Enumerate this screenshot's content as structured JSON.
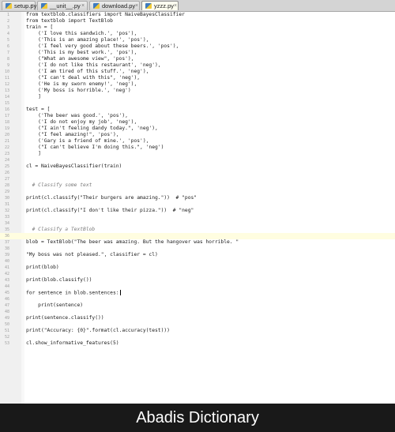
{
  "tabs": [
    {
      "label": "setup.py",
      "active": false
    },
    {
      "label": "__unit__.py",
      "active": false
    },
    {
      "label": "download.py",
      "active": false
    },
    {
      "label": "yzzz.py",
      "active": true
    }
  ],
  "tab_close_glyph": "×",
  "editor": {
    "cursor_line": 36,
    "lines": [
      {
        "n": 1,
        "text": "from textblob.classifiers import NaiveBayesClassifier"
      },
      {
        "n": 2,
        "text": "from textblob import TextBlob"
      },
      {
        "n": 3,
        "text": "train = ["
      },
      {
        "n": 4,
        "text": "    ('I love this sandwich.', 'pos'),"
      },
      {
        "n": 5,
        "text": "    ('This is an amazing place!', 'pos'),"
      },
      {
        "n": 6,
        "text": "    ('I feel very good about these beers.', 'pos'),"
      },
      {
        "n": 7,
        "text": "    ('This is my best work.', 'pos'),"
      },
      {
        "n": 8,
        "text": "    (\"What an awesome view\", 'pos'),"
      },
      {
        "n": 9,
        "text": "    ('I do not like this restaurant', 'neg'),"
      },
      {
        "n": 10,
        "text": "    ('I am tired of this stuff.', 'neg'),"
      },
      {
        "n": 11,
        "text": "    (\"I can't deal with this\", 'neg'),"
      },
      {
        "n": 12,
        "text": "    ('He is my sworn enemy!', 'neg'),"
      },
      {
        "n": 13,
        "text": "    ('My boss is horrible.', 'neg')"
      },
      {
        "n": 14,
        "text": "    ]"
      },
      {
        "n": 15,
        "text": ""
      },
      {
        "n": 16,
        "text": "test = ["
      },
      {
        "n": 17,
        "text": "    ('The beer was good.', 'pos'),"
      },
      {
        "n": 18,
        "text": "    ('I do not enjoy my job', 'neg'),"
      },
      {
        "n": 19,
        "text": "    (\"I ain't feeling dandy today.\", 'neg'),"
      },
      {
        "n": 20,
        "text": "    (\"I feel amazing!\", 'pos'),"
      },
      {
        "n": 21,
        "text": "    ('Gary is a friend of mine.', 'pos'),"
      },
      {
        "n": 22,
        "text": "    (\"I can't believe I'm doing this.\", 'neg')"
      },
      {
        "n": 23,
        "text": "    ]"
      },
      {
        "n": 24,
        "text": ""
      },
      {
        "n": 25,
        "text": "cl = NaiveBayesClassifier(train)"
      },
      {
        "n": 26,
        "text": ""
      },
      {
        "n": 27,
        "text": ""
      },
      {
        "n": 28,
        "text": "  # Classify some text",
        "comment": true
      },
      {
        "n": 29,
        "text": ""
      },
      {
        "n": 30,
        "text": "print(cl.classify(\"Their burgers are amazing.\"))  # \"pos\""
      },
      {
        "n": 31,
        "text": ""
      },
      {
        "n": 32,
        "text": "print(cl.classify(\"I don't like their pizza.\"))  # \"neg\""
      },
      {
        "n": 33,
        "text": ""
      },
      {
        "n": 34,
        "text": ""
      },
      {
        "n": 35,
        "text": "  # Classify a TextBlob",
        "comment": true
      },
      {
        "n": 36,
        "text": ""
      },
      {
        "n": 37,
        "text": "blob = TextBlob(\"The beer was amazing. But the hangover was horrible. \""
      },
      {
        "n": 38,
        "text": ""
      },
      {
        "n": 39,
        "text": "\"My boss was not pleased.\", classifier = cl)"
      },
      {
        "n": 40,
        "text": ""
      },
      {
        "n": 41,
        "text": "print(blob)"
      },
      {
        "n": 42,
        "text": ""
      },
      {
        "n": 43,
        "text": "print(blob.classify())"
      },
      {
        "n": 44,
        "text": ""
      },
      {
        "n": 45,
        "text": "for sentence in blob.sentences:"
      },
      {
        "n": 46,
        "text": ""
      },
      {
        "n": 47,
        "text": "    print(sentence)"
      },
      {
        "n": 48,
        "text": ""
      },
      {
        "n": 49,
        "text": "print(sentence.classify())"
      },
      {
        "n": 50,
        "text": ""
      },
      {
        "n": 51,
        "text": "print(\"Accuracy: {0}\".format(cl.accuracy(test)))"
      },
      {
        "n": 52,
        "text": ""
      },
      {
        "n": 53,
        "text": "cl.show_informative_features(5)"
      }
    ]
  },
  "footer_banner": "Abadis Dictionary",
  "colors": {
    "tabbar_bg": "#d4d4d4",
    "active_tab_bg": "#fdfdf0",
    "gutter_bg": "#f0f0f0",
    "line_number": "#a0a0a0",
    "comment": "#7a7a7a",
    "current_line": "#fffde0",
    "banner_bg": "#191919"
  },
  "icons": [
    "python-file-icon",
    "close-icon"
  ]
}
